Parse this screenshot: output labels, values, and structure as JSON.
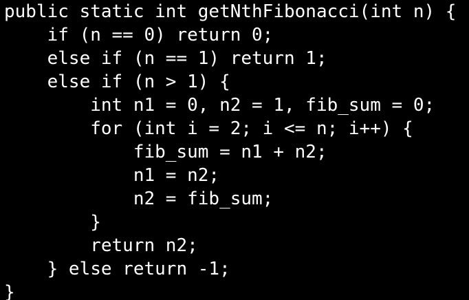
{
  "editor": {
    "background": "#000000",
    "foreground": "#ffffff",
    "lines": [
      "public static int getNthFibonacci(int n) {",
      "    if (n == 0) return 0;",
      "    else if (n == 1) return 1;",
      "    else if (n > 1) {",
      "        int n1 = 0, n2 = 1, fib_sum = 0;",
      "        for (int i = 2; i <= n; i++) {",
      "            fib_sum = n1 + n2;",
      "            n1 = n2;",
      "            n2 = fib_sum;",
      "        }",
      "        return n2;",
      "    } else return -1;",
      "}"
    ]
  }
}
